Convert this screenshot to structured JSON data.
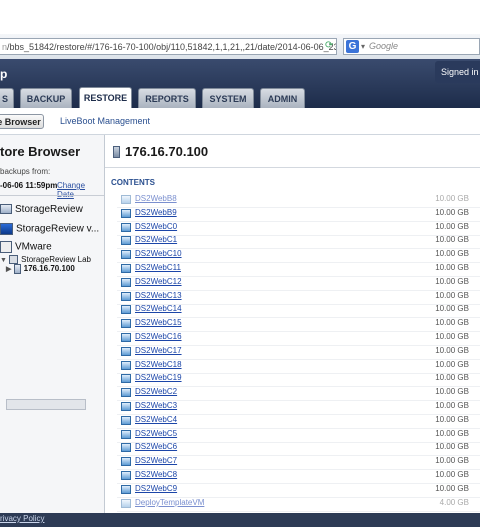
{
  "browser": {
    "url_host": "n",
    "url_path": "/bbs_51842/restore/#/176-16-70-100/obj/110,51842,1,1,21,,21/date/2014-06-06_23:5",
    "search_engine_icon": "G",
    "search_placeholder": "Google"
  },
  "header": {
    "app_title": "p",
    "signed_in_text": "Signed in as"
  },
  "tabs": [
    {
      "label": "S"
    },
    {
      "label": "BACKUP"
    },
    {
      "label": "RESTORE",
      "active": true
    },
    {
      "label": "REPORTS"
    },
    {
      "label": "SYSTEM"
    },
    {
      "label": "ADMIN"
    }
  ],
  "subbar": {
    "browser_button": "e Browser",
    "liveboot_link": "LiveBoot Management"
  },
  "left": {
    "title": "tore Browser",
    "info": "backups from:",
    "date": "-06-06 11:59pm",
    "change_date": "Change Date",
    "tree": [
      {
        "label": "StorageReview",
        "icon": "server-icon"
      },
      {
        "label": "StorageReview v...",
        "icon": "monitor-icon"
      },
      {
        "label": "VMware",
        "icon": "vm-icon"
      },
      {
        "label": "StorageReview Lab",
        "icon": "folder-icon"
      },
      {
        "label": "176.16.70.100",
        "icon": "host-icon",
        "selected": true
      }
    ]
  },
  "right": {
    "host_title": "176.16.70.100",
    "section_title": "CONTENTS",
    "items": [
      {
        "name": "DS2WebB8",
        "size": "10.00 GB",
        "faded": true
      },
      {
        "name": "DS2WebB9",
        "size": "10.00 GB"
      },
      {
        "name": "DS2WebC0",
        "size": "10.00 GB"
      },
      {
        "name": "DS2WebC1",
        "size": "10.00 GB"
      },
      {
        "name": "DS2WebC10",
        "size": "10.00 GB"
      },
      {
        "name": "DS2WebC11",
        "size": "10.00 GB"
      },
      {
        "name": "DS2WebC12",
        "size": "10.00 GB"
      },
      {
        "name": "DS2WebC13",
        "size": "10.00 GB"
      },
      {
        "name": "DS2WebC14",
        "size": "10.00 GB"
      },
      {
        "name": "DS2WebC15",
        "size": "10.00 GB"
      },
      {
        "name": "DS2WebC16",
        "size": "10.00 GB"
      },
      {
        "name": "DS2WebC17",
        "size": "10.00 GB"
      },
      {
        "name": "DS2WebC18",
        "size": "10.00 GB"
      },
      {
        "name": "DS2WebC19",
        "size": "10.00 GB"
      },
      {
        "name": "DS2WebC2",
        "size": "10.00 GB"
      },
      {
        "name": "DS2WebC3",
        "size": "10.00 GB"
      },
      {
        "name": "DS2WebC4",
        "size": "10.00 GB"
      },
      {
        "name": "DS2WebC5",
        "size": "10.00 GB"
      },
      {
        "name": "DS2WebC6",
        "size": "10.00 GB"
      },
      {
        "name": "DS2WebC7",
        "size": "10.00 GB"
      },
      {
        "name": "DS2WebC8",
        "size": "10.00 GB"
      },
      {
        "name": "DS2WebC9",
        "size": "10.00 GB"
      },
      {
        "name": "DeployTemplateVM",
        "size": "4.00 GB",
        "faded": true
      }
    ]
  },
  "footer": {
    "privacy": "rivacy Policy"
  }
}
